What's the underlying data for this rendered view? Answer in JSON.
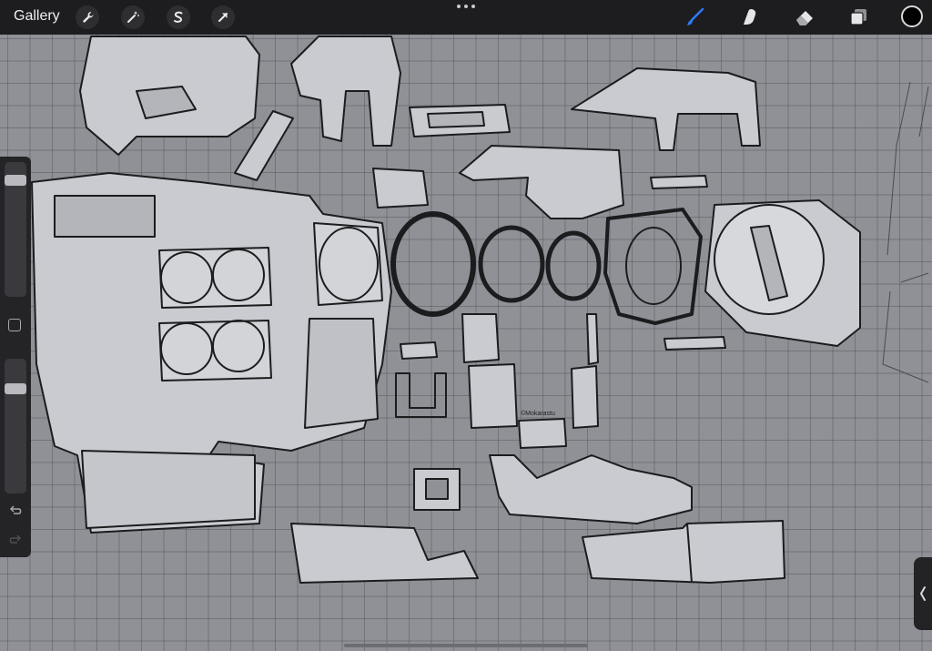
{
  "topbar": {
    "gallery_label": "Gallery",
    "left_tools": [
      {
        "name": "actions",
        "icon": "wrench-icon"
      },
      {
        "name": "adjustments",
        "icon": "magic-wand-icon"
      },
      {
        "name": "selection",
        "icon": "selection-s-icon"
      },
      {
        "name": "transform",
        "icon": "arrow-cursor-icon"
      }
    ],
    "right_tools": [
      {
        "name": "brush",
        "icon": "brush-icon",
        "active": true,
        "color": "#2f7bf6"
      },
      {
        "name": "smudge",
        "icon": "smudge-finger-icon",
        "active": false
      },
      {
        "name": "eraser",
        "icon": "eraser-icon",
        "active": false
      },
      {
        "name": "layers",
        "icon": "layers-icon",
        "active": false
      }
    ],
    "current_color": "#000000"
  },
  "sidebar": {
    "brush_size_level": 0.9,
    "opacity_level": 0.8,
    "controls": [
      "brush-size-slider",
      "modify-button",
      "opacity-slider",
      "undo",
      "redo"
    ]
  },
  "canvas": {
    "signature": "©Mokarastu"
  },
  "colors": {
    "toolbar_bg": "#1d1d1f",
    "canvas_bg": "#8f9197",
    "part_fill": "#c9cbd0",
    "ink": "#1c1c1e",
    "accent": "#2f7bf6"
  }
}
